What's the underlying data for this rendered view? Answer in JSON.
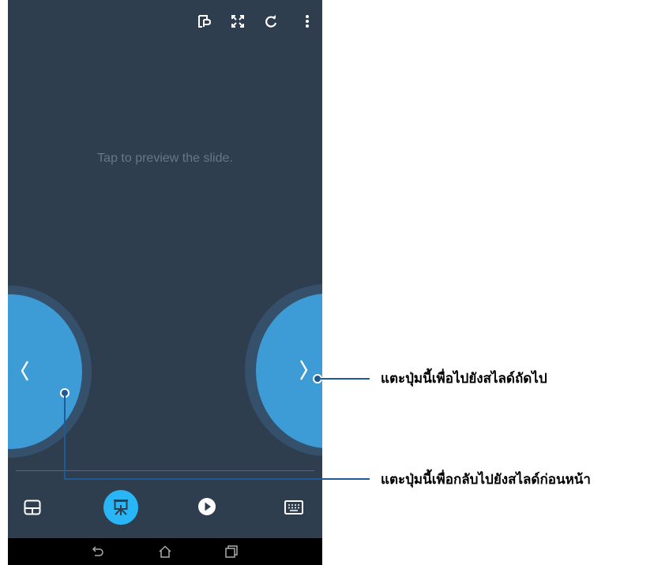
{
  "colors": {
    "screen_bg": "#2f3e4e",
    "nav_button": "#3d9bd6",
    "nav_ring": "#34506a",
    "active_tool": "#29b6f6",
    "callout_line": "#1f5a96"
  },
  "top_icons": [
    "presenter-notes-icon",
    "fullscreen-icon",
    "sync-icon",
    "more-options-icon"
  ],
  "preview": {
    "text": "Tap to preview the slide."
  },
  "nav": {
    "prev_icon": "chevron-left-icon",
    "next_icon": "chevron-right-icon"
  },
  "toolbar": {
    "items": [
      "touchpad-icon",
      "presentation-icon",
      "play-icon",
      "keyboard-icon"
    ],
    "active_index": 1
  },
  "system_nav": [
    "back-icon",
    "home-icon",
    "recent-apps-icon"
  ],
  "callouts": {
    "next": "แตะปุ่มนี้เพื่อไปยังสไลด์ถัดไป",
    "prev": "แตะปุ่มนี้เพื่อกลับไปยังสไลด์ก่อนหน้า"
  }
}
